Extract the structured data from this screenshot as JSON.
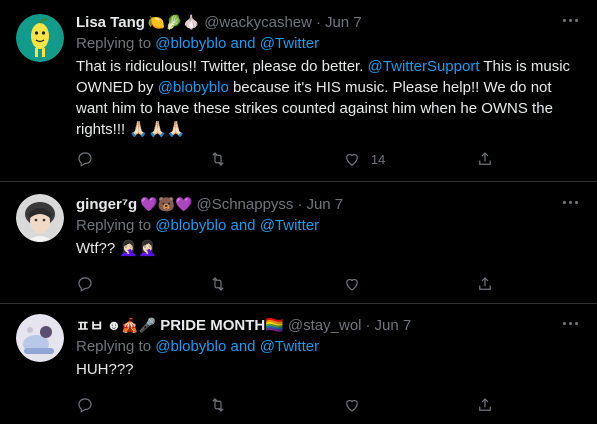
{
  "tweets": [
    {
      "name": "Lisa Tang",
      "name_emojis": "🍋🥬🧄",
      "handle": "@wackycashew",
      "separator": "·",
      "date": "Jun 7",
      "replying_prefix": "Replying to",
      "replying_user1": "@blobyblo",
      "replying_and": "and",
      "replying_user2": "@Twitter",
      "text_part1": "That is ridiculous!! Twitter, please do better. ",
      "mention1": "@TwitterSupport",
      "text_part2": " This is music OWNED by ",
      "mention2": "@blobyblo",
      "text_part3": " because it's HIS music. Please help!! We do not want him to have these strikes counted against him when he OWNS the rights!!! 🙏🏻🙏🏻🙏🏻",
      "like_count": "14"
    },
    {
      "name": "ginger⁷g",
      "name_emojis": "💜🐻💜",
      "handle": "@Schnappyss",
      "separator": "·",
      "date": "Jun 7",
      "replying_prefix": "Replying to",
      "replying_user1": "@blobyblo",
      "replying_and": "and",
      "replying_user2": "@Twitter",
      "text": "Wtf?? 🤦🏻‍♀️🤦🏻‍♀️"
    },
    {
      "name": "ㅍㅂ",
      "name_emojis": "☻🎪🎤",
      "name_suffix": "PRIDE MONTH🏳️‍🌈",
      "handle": "@stay_wol",
      "separator": "·",
      "date": "Jun 7",
      "replying_prefix": "Replying to",
      "replying_user1": "@blobyblo",
      "replying_and": "and",
      "replying_user2": "@Twitter",
      "text": "HUH???"
    }
  ],
  "icons": [
    "reply-icon",
    "retweet-icon",
    "like-icon",
    "share-icon",
    "more-icon"
  ],
  "colors": {
    "background": "#000000",
    "text": "#e7e9ea",
    "muted": "#71767b",
    "link": "#1d9bf0",
    "divider": "#2f3336"
  }
}
